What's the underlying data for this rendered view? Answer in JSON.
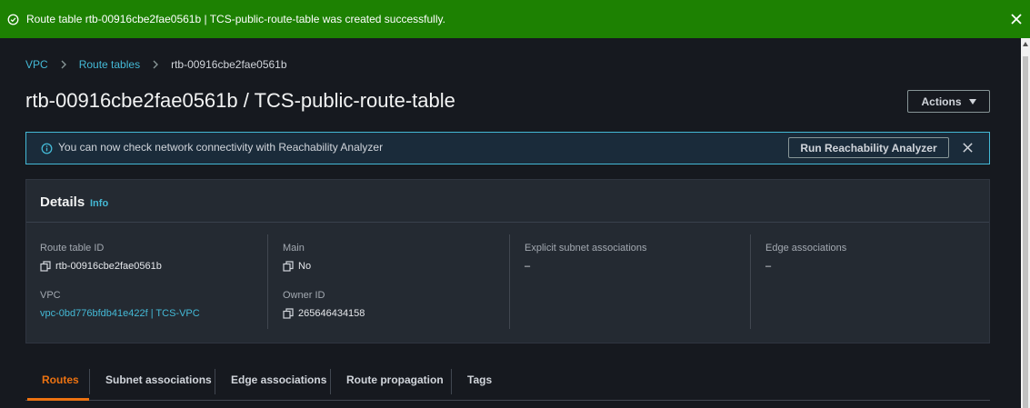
{
  "flash": {
    "message": "Route table rtb-00916cbe2fae0561b | TCS-public-route-table was created successfully.",
    "color": "#1d8102"
  },
  "breadcrumb": {
    "items": [
      "VPC",
      "Route tables"
    ],
    "current": "rtb-00916cbe2fae0561b"
  },
  "page": {
    "title": "rtb-00916cbe2fae0561b / TCS-public-route-table",
    "actions_label": "Actions"
  },
  "alert": {
    "message": "You can now check network connectivity with Reachability Analyzer",
    "button_label": "Run Reachability Analyzer"
  },
  "details": {
    "heading": "Details",
    "info_link": "Info",
    "route_table_id_label": "Route table ID",
    "route_table_id": "rtb-00916cbe2fae0561b",
    "vpc_label": "VPC",
    "vpc_value": "vpc-0bd776bfdb41e422f | TCS-VPC",
    "main_label": "Main",
    "main_value": "No",
    "owner_label": "Owner ID",
    "owner_value": "265646434158",
    "explicit_label": "Explicit subnet associations",
    "explicit_value": "–",
    "edge_label": "Edge associations",
    "edge_value": "–"
  },
  "tabs": [
    "Routes",
    "Subnet associations",
    "Edge associations",
    "Route propagation",
    "Tags"
  ],
  "active_tab": "Routes",
  "colors": {
    "accent": "#ec7211",
    "link": "#44b9d6",
    "background": "#16191f",
    "panel": "#242a32"
  }
}
